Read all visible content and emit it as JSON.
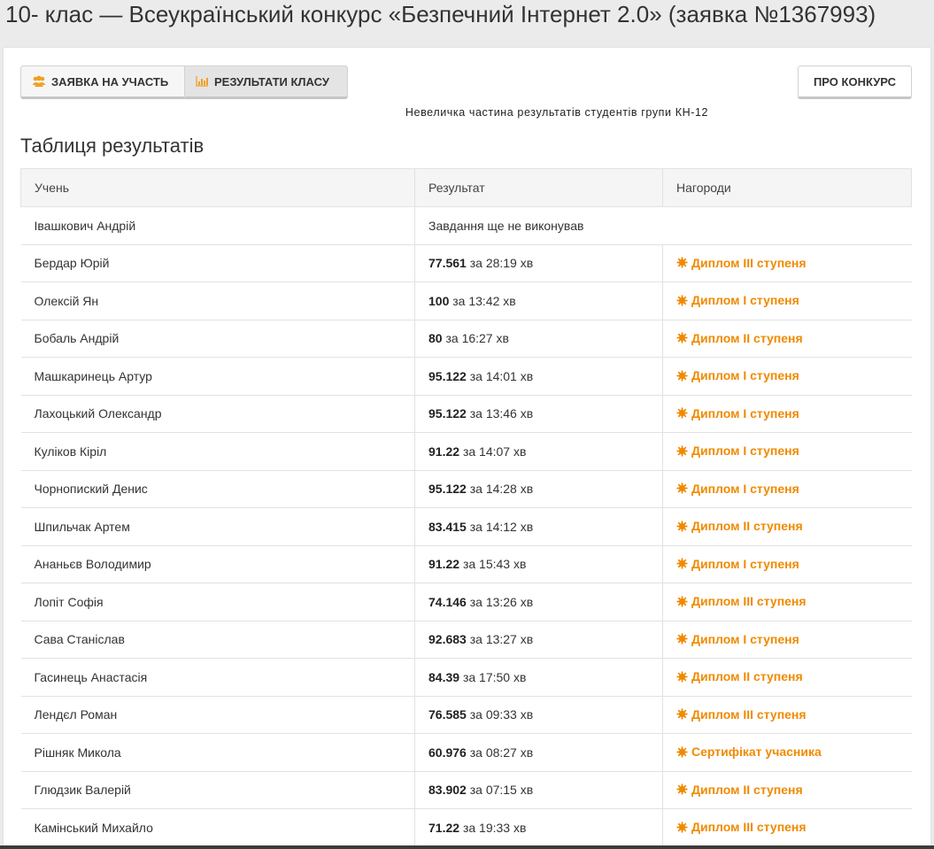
{
  "header": {
    "title": "10- клас — Всеукраїнський конкурс «Безпечний Інтернет 2.0» (заявка №1367993)"
  },
  "toolbar": {
    "apply_label": "ЗАЯВКА НА УЧАСТЬ",
    "results_label": "РЕЗУЛЬТАТИ КЛАСУ",
    "about_label": "ПРО КОНКУРС"
  },
  "note": "Невеличка частина результатів студентів групи КН-12",
  "section_title": "Таблиця результатів",
  "table": {
    "headers": [
      "Учень",
      "Результат",
      "Нагороди"
    ],
    "rows": [
      {
        "name": "Івашкович Андрій",
        "score": "",
        "time": "Завдання ще не виконував",
        "award": ""
      },
      {
        "name": "Бердар Юрій",
        "score": "77.561",
        "time": "за 28:19 хв",
        "award": "Диплом III ступеня"
      },
      {
        "name": "Олексій Ян",
        "score": "100",
        "time": "за 13:42 хв",
        "award": "Диплом I ступеня"
      },
      {
        "name": "Бобаль Андрій",
        "score": "80",
        "time": "за 16:27 хв",
        "award": "Диплом II ступеня"
      },
      {
        "name": "Машкаринець Артур",
        "score": "95.122",
        "time": "за 14:01 хв",
        "award": "Диплом I ступеня"
      },
      {
        "name": "Лахоцький Олександр",
        "score": "95.122",
        "time": "за 13:46 хв",
        "award": "Диплом I ступеня"
      },
      {
        "name": "Куліков Кіріл",
        "score": "91.22",
        "time": "за 14:07 хв",
        "award": "Диплом I ступеня"
      },
      {
        "name": "Чорнопиский Денис",
        "score": "95.122",
        "time": "за 14:28 хв",
        "award": "Диплом I ступеня"
      },
      {
        "name": "Шпильчак Артем",
        "score": "83.415",
        "time": "за 14:12 хв",
        "award": "Диплом II ступеня"
      },
      {
        "name": "Ананьєв Володимир",
        "score": "91.22",
        "time": "за 15:43 хв",
        "award": "Диплом I ступеня"
      },
      {
        "name": "Лопіт Софія",
        "score": "74.146",
        "time": "за 13:26 хв",
        "award": "Диплом III ступеня"
      },
      {
        "name": "Сава Станіслав",
        "score": "92.683",
        "time": "за 13:27 хв",
        "award": "Диплом I ступеня"
      },
      {
        "name": "Гасинець Анастасія",
        "score": "84.39",
        "time": "за 17:50 хв",
        "award": "Диплом II ступеня"
      },
      {
        "name": "Лендєл Роман",
        "score": "76.585",
        "time": "за 09:33 хв",
        "award": "Диплом III ступеня"
      },
      {
        "name": "Рішняк Микола",
        "score": "60.976",
        "time": "за 08:27 хв",
        "award": "Сертифікат учасника"
      },
      {
        "name": "Глюдзик Валерій",
        "score": "83.902",
        "time": "за 07:15 хв",
        "award": "Диплом II ступеня"
      },
      {
        "name": "Камінський Михайло",
        "score": "71.22",
        "time": "за 19:33 хв",
        "award": "Диплом III ступеня"
      }
    ]
  },
  "colors": {
    "award": "#f08a00",
    "users_icon": "#f0a020"
  },
  "icons": {
    "apply": "users-icon",
    "results": "bar-chart-icon",
    "award": "award-icon"
  }
}
